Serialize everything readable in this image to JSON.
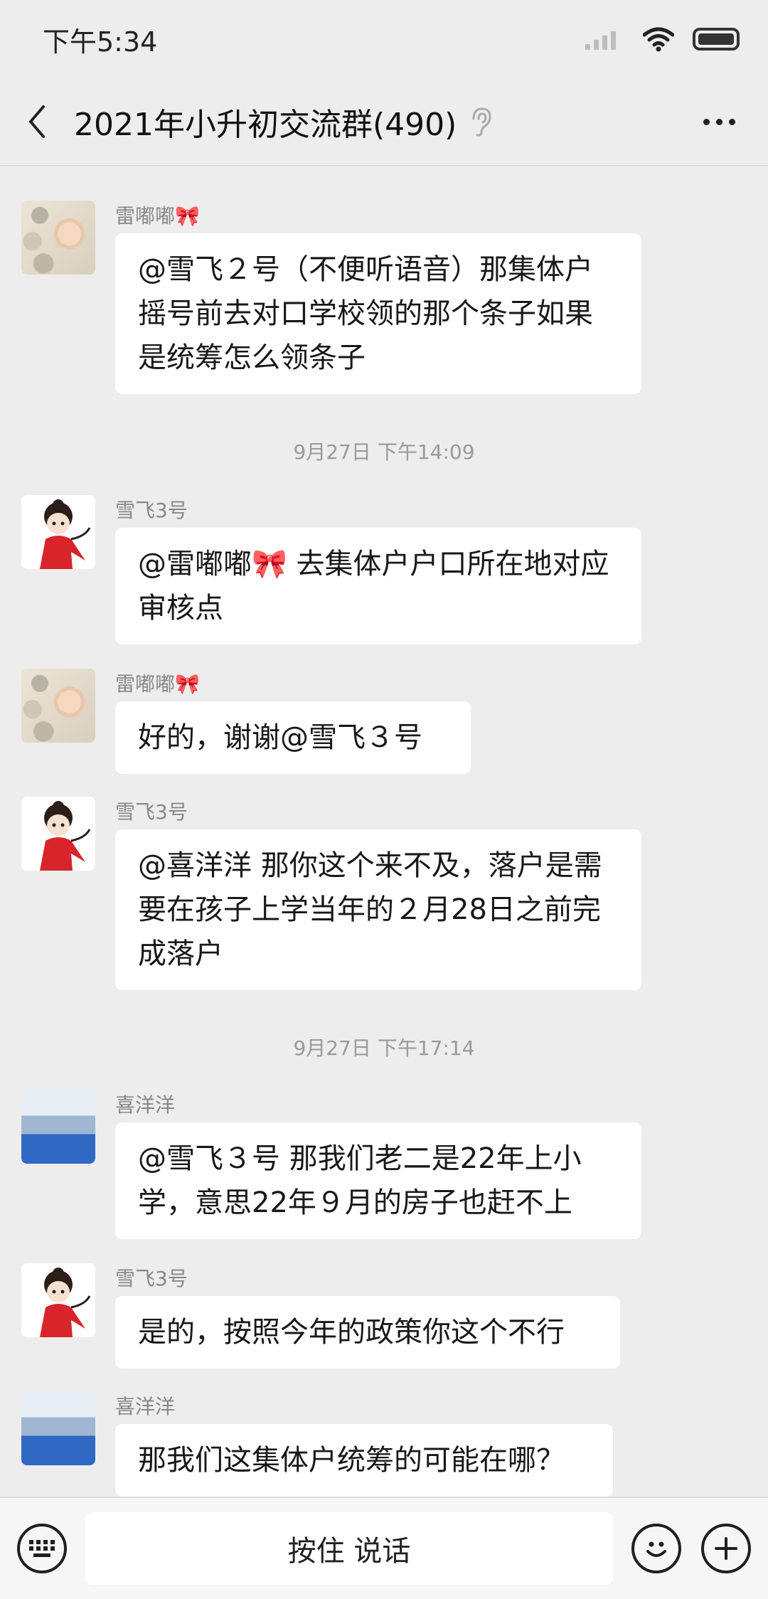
{
  "status_bar": {
    "time": "下午5:34"
  },
  "header": {
    "title": "2021年小升初交流群(490)"
  },
  "messages": [
    {
      "sender": "雷嘟嘟🎀",
      "text": "@雪飞２号（不便听语音）那集体户摇号前去对口学校领的那个条子如果是统筹怎么领条子"
    },
    {
      "timestamp": "9月27日 下午14:09"
    },
    {
      "sender": "雪飞3号",
      "text": "@雷嘟嘟🎀 去集体户户口所在地对应审核点"
    },
    {
      "sender": "雷嘟嘟🎀",
      "text": "好的，谢谢@雪飞３号"
    },
    {
      "sender": "雪飞3号",
      "text": "@喜洋洋  那你这个来不及，落户是需要在孩子上学当年的２月28日之前完成落户"
    },
    {
      "timestamp": "9月27日 下午17:14"
    },
    {
      "sender": "喜洋洋",
      "text": "@雪飞３号  那我们老二是22年上小学，意思22年９月的房子也赶不上"
    },
    {
      "sender": "雪飞3号",
      "text": "是的，按照今年的政策你这个不行"
    },
    {
      "sender": "喜洋洋",
      "text": "那我们这集体户统筹的可能在哪？"
    }
  ],
  "input_bar": {
    "voice_label": "按住 说话"
  }
}
